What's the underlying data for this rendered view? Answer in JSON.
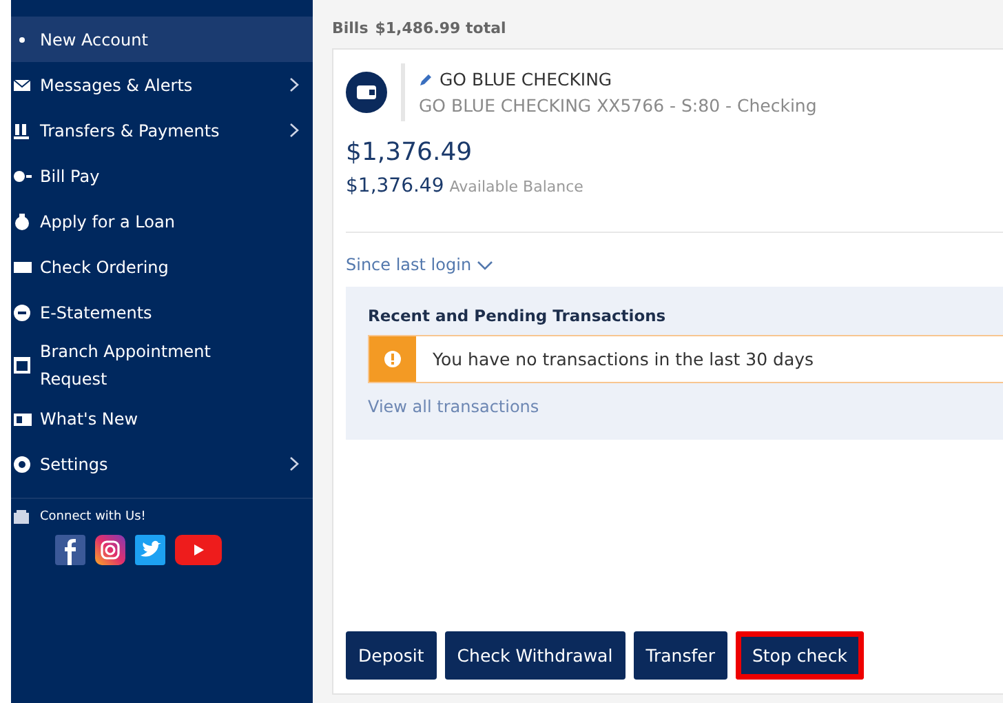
{
  "sidebar": {
    "items": [
      {
        "label": "New Account",
        "selected": true,
        "has_submenu": false
      },
      {
        "label": "Messages & Alerts",
        "selected": false,
        "has_submenu": true
      },
      {
        "label": "Transfers & Payments",
        "selected": false,
        "has_submenu": true
      },
      {
        "label": "Bill Pay",
        "selected": false,
        "has_submenu": false
      },
      {
        "label": "Apply for a Loan",
        "selected": false,
        "has_submenu": false
      },
      {
        "label": "Check Ordering",
        "selected": false,
        "has_submenu": false
      },
      {
        "label": "E-Statements",
        "selected": false,
        "has_submenu": false
      },
      {
        "label": "Branch Appointment Request",
        "selected": false,
        "has_submenu": false
      },
      {
        "label": "What's New",
        "selected": false,
        "has_submenu": false
      },
      {
        "label": "Settings",
        "selected": false,
        "has_submenu": true
      }
    ],
    "connect_label": "Connect with Us!"
  },
  "bills_header": {
    "label": "Bills",
    "total": "$1,486.99 total"
  },
  "account": {
    "nickname": "GO BLUE CHECKING",
    "description": "GO BLUE CHECKING XX5766 - S:80 - Checking",
    "balance": "$1,376.49",
    "available_balance": "$1,376.49",
    "available_label": "Available Balance",
    "since_last_login": "Since last login"
  },
  "transactions": {
    "title": "Recent and Pending Transactions",
    "alert": "You have no transactions in the last 30 days",
    "view_all": "View all transactions"
  },
  "actions": [
    {
      "label": "Deposit",
      "highlighted": false
    },
    {
      "label": "Check Withdrawal",
      "highlighted": false
    },
    {
      "label": "Transfer",
      "highlighted": false
    },
    {
      "label": "Stop check",
      "highlighted": true
    }
  ]
}
